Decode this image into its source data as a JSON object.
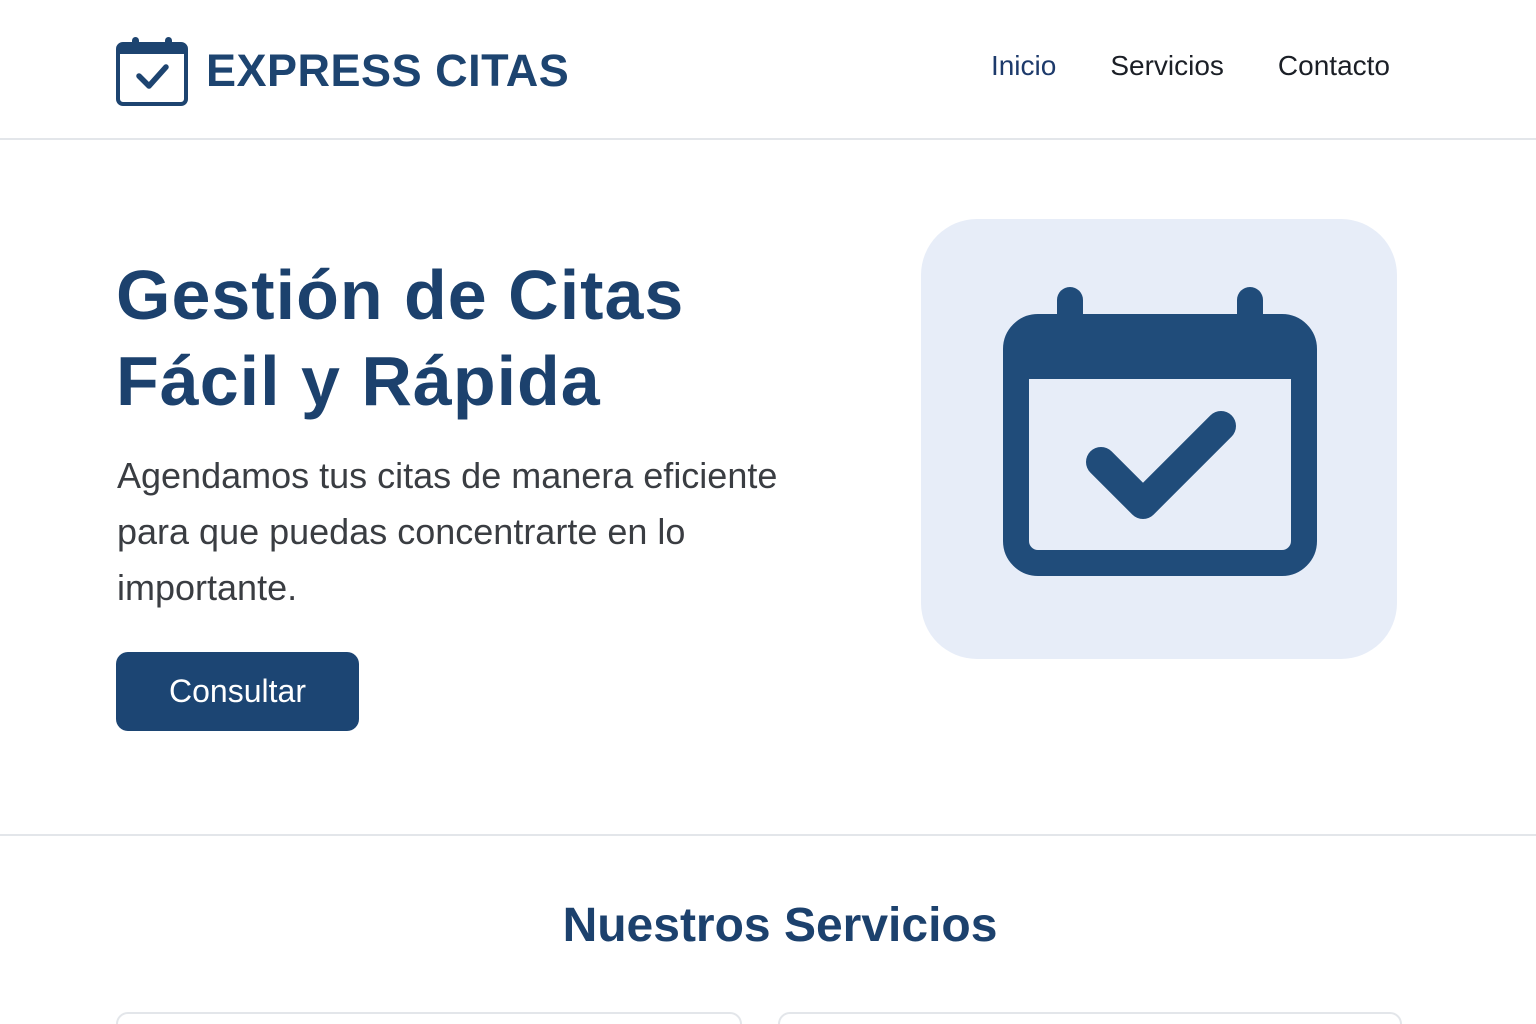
{
  "header": {
    "brand": "EXPRESS CITAS",
    "logo_icon": "calendar-check-icon",
    "nav": [
      {
        "label": "Inicio",
        "active": true
      },
      {
        "label": "Servicios",
        "active": false
      },
      {
        "label": "Contacto",
        "active": false
      }
    ]
  },
  "hero": {
    "title_line1": "Gestión de Citas",
    "title_line2": "Fácil y Rápida",
    "description": "Agendamos tus citas de manera eficiente para que puedas concentrarte en lo importante.",
    "cta_label": "Consultar",
    "illustration_icon": "calendar-check-icon"
  },
  "services": {
    "title": "Nuestros Servicios"
  },
  "colors": {
    "brand": "#1c416d",
    "button": "#1c4573",
    "illustration_bg": "#e7edf8",
    "illustration_icon": "#204c7a"
  }
}
